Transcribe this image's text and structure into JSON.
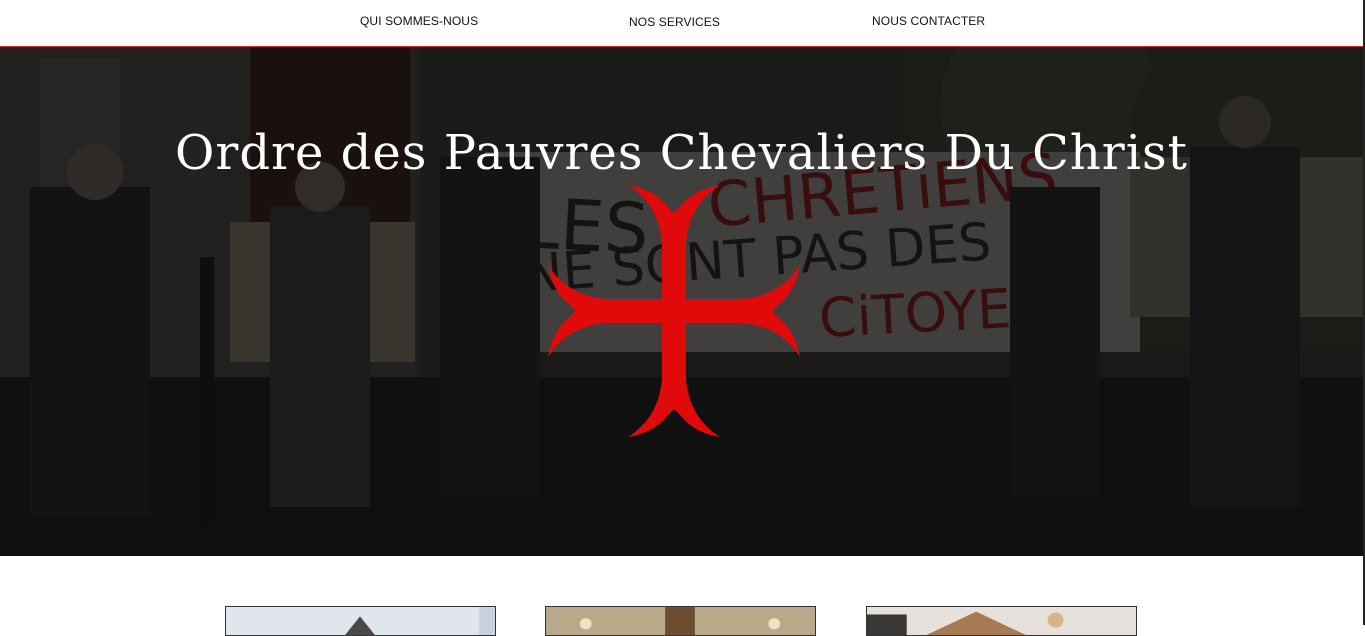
{
  "nav": {
    "items": [
      {
        "label": "QUI SOMMES-NOUS"
      },
      {
        "label": "NOS SERVICES"
      },
      {
        "label": "NOUS CONTACTER"
      }
    ]
  },
  "hero": {
    "title": "Ordre des Pauvres Chevaliers Du Christ",
    "cross_color": "#e00a0a",
    "overlay_color": "#000000"
  },
  "cards": {
    "count_visible": 3
  }
}
